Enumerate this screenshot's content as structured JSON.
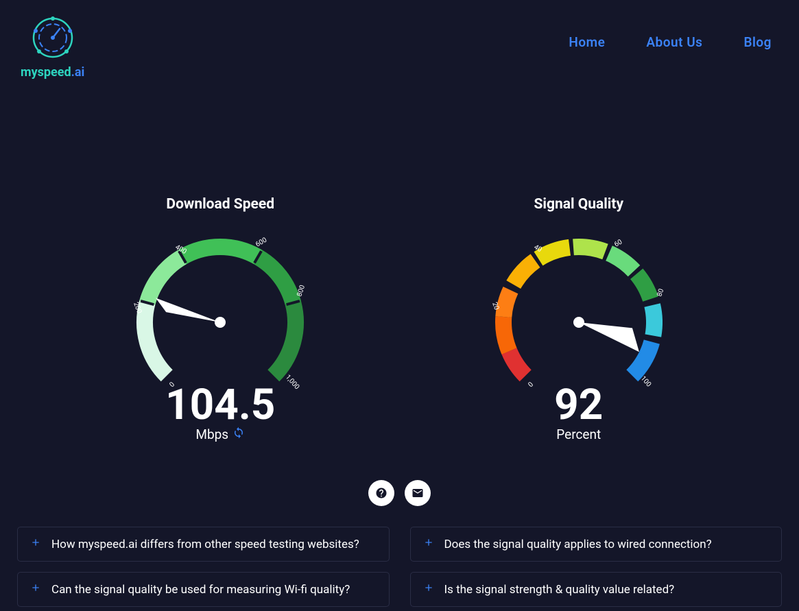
{
  "brand": {
    "my": "my",
    "speed": "speed",
    "dot_ai": ".ai"
  },
  "nav": {
    "home": "Home",
    "about": "About Us",
    "blog": "Blog"
  },
  "gauges": {
    "download": {
      "title": "Download Speed",
      "value": "104.5",
      "unit": "Mbps",
      "ticks": [
        "0",
        "200",
        "400",
        "600",
        "800",
        "1,000"
      ]
    },
    "signal": {
      "title": "Signal Quality",
      "value": "92",
      "unit": "Percent",
      "ticks": [
        "0",
        "20",
        "40",
        "60",
        "80",
        "100"
      ]
    }
  },
  "faq": {
    "q1": "How myspeed.ai differs from other speed testing websites?",
    "q2": "Does the signal quality applies to wired connection?",
    "q3": "Can the signal quality be used for measuring Wi-fi quality?",
    "q4": "Is the signal strength & quality value related?"
  },
  "chart_data": [
    {
      "type": "gauge",
      "name": "Download Speed",
      "value": 104.5,
      "unit": "Mbps",
      "min": 0,
      "max": 1000,
      "ticks": [
        0,
        200,
        400,
        600,
        800,
        1000
      ]
    },
    {
      "type": "gauge",
      "name": "Signal Quality",
      "value": 92,
      "unit": "Percent",
      "min": 0,
      "max": 100,
      "ticks": [
        0,
        20,
        40,
        60,
        80,
        100
      ]
    }
  ]
}
